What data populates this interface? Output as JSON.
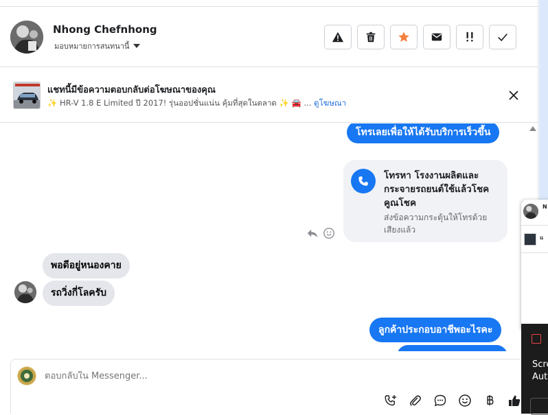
{
  "header": {
    "contact_name": "Nhong Chefnhong",
    "assign_label": "มอบหมายการสนทนานี้",
    "actions": [
      "alert-icon",
      "trash-icon",
      "star-icon",
      "mail-icon",
      "spam-icon",
      "check-icon"
    ]
  },
  "ad_banner": {
    "title": "แชทนี้มีข้อความตอบกลับต่อโฆษณาของคุณ",
    "description": "✨ HR-V 1.8 E Limited ปี 2017! รุ่นออปชั่นแน่น คุ้มที่สุดในตลาด ✨ 🚘 ...",
    "link": "ดูโฆษณา"
  },
  "thread": {
    "out_1": "โทรเลยเพื่อให้ได้รับบริการเร็วขึ้น",
    "call_card": {
      "title": "โทรหา โรงงานผลิตและกระจายรถยนต์ใช้แล้วโชคคูณโชค",
      "description": "ส่งข้อความกระตุ้นให้โทรด้วยเสียงแล้ว"
    },
    "in_1": "พอดีอยู่หนองคาย",
    "in_2": "รถวิ่งกี่โลครับ",
    "out_2": "ลูกค้าประกอบอาชีพอะไรคะ"
  },
  "composer": {
    "placeholder": "ตอบกลับใน Messenger..."
  },
  "popup_peek": {
    "name_fragment": "N",
    "banner_fragment": "แ",
    "dark_text_1": "Scre",
    "dark_text_2": "Auto"
  },
  "colors": {
    "accent": "#1877f2",
    "star": "#f5803e"
  }
}
